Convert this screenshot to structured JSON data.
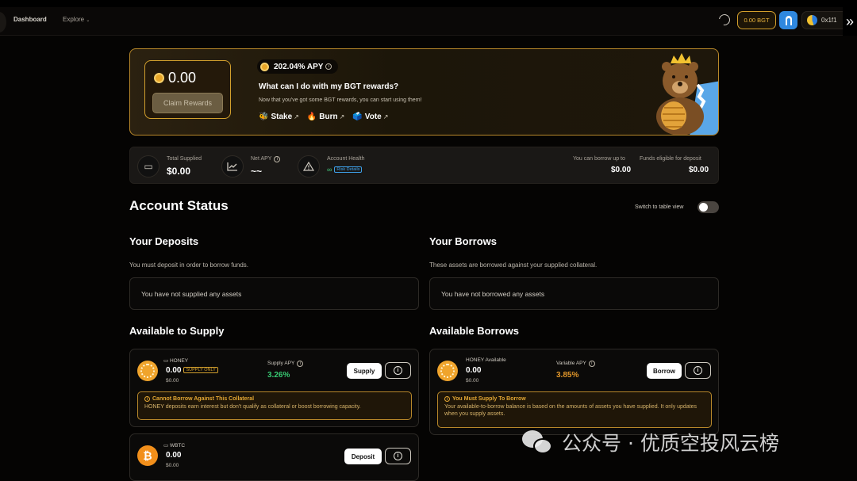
{
  "nav": {
    "dashboard": "Dashboard",
    "explore": "Explore",
    "bgt_balance": "0.00 BGT",
    "wallet": "0x1f1"
  },
  "banner": {
    "claim_amount": "0.00",
    "claim_button": "Claim Rewards",
    "apy": "202.04% APY",
    "question": "What can I do with my BGT rewards?",
    "subtitle": "Now that you've got some BGT rewards, you can start using them!",
    "actions": [
      {
        "emoji": "🐝",
        "label": "Stake"
      },
      {
        "emoji": "🔥",
        "label": "Burn"
      },
      {
        "emoji": "🗳️",
        "label": "Vote"
      }
    ]
  },
  "stats": {
    "total_supplied_label": "Total Supplied",
    "total_supplied_value": "$0.00",
    "net_apy_label": "Net APY",
    "net_apy_value": "~~",
    "health_label": "Account Health",
    "health_value": "∞",
    "risk_details": "Risk Details",
    "borrow_up_to_label": "You can borrow up to",
    "borrow_up_to_value": "$0.00",
    "funds_eligible_label": "Funds eligible for deposit",
    "funds_eligible_value": "$0.00"
  },
  "account_status": {
    "title": "Account Status",
    "toggle_label": "Switch to table view"
  },
  "deposits": {
    "title": "Your Deposits",
    "subtitle": "You must deposit in order to borrow funds.",
    "empty": "You have not supplied any assets"
  },
  "borrows": {
    "title": "Your Borrows",
    "subtitle": "These assets are borrowed against your supplied collateral.",
    "empty": "You have not borrowed any assets"
  },
  "supply": {
    "title": "Available to Supply",
    "honey": {
      "name": "HONEY",
      "amount": "0.00",
      "badge": "SUPPLY ONLY",
      "usd": "$0.00",
      "apy_label": "Supply APY",
      "apy_value": "3.26%",
      "button": "Supply",
      "warn_title": "Cannot Borrow Against This Collateral",
      "warn_text": "HONEY deposits earn interest but don't qualify as collateral or boost borrowing capacity."
    },
    "wbtc": {
      "name": "WBTC",
      "amount": "0.00",
      "usd": "$0.00",
      "button": "Deposit"
    }
  },
  "borrow_list": {
    "title": "Available Borrows",
    "honey": {
      "name": "HONEY Available",
      "amount": "0.00",
      "usd": "$0.00",
      "apy_label": "Variable APY",
      "apy_value": "3.85%",
      "button": "Borrow",
      "warn_title": "You Must Supply To Borrow",
      "warn_text": "Your available-to-borrow balance is based on the amounts of assets you have supplied. It only updates when you supply assets."
    }
  },
  "watermark": "公众号 · 优质空投风云榜",
  "colors": {
    "accent_gold": "#d3a02d",
    "positive_green": "#37c871",
    "borrow_orange": "#e2972a",
    "link_blue": "#3ea0e8"
  }
}
